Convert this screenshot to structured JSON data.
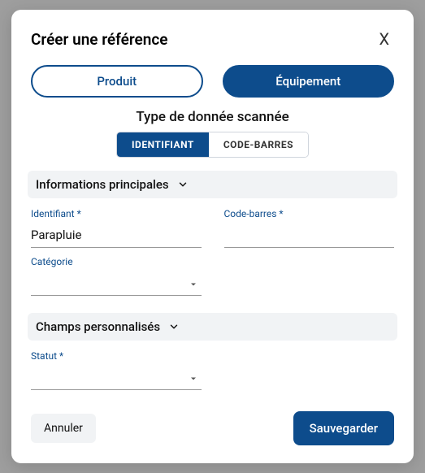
{
  "modal": {
    "title": "Créer une référence",
    "close": "X"
  },
  "tabs": {
    "product": "Produit",
    "equipment": "Équipement"
  },
  "scan": {
    "title": "Type de donnée scannée",
    "identifier": "IDENTIFIANT",
    "barcode": "CODE-BARRES"
  },
  "sections": {
    "main": "Informations principales",
    "custom": "Champs personnalisés"
  },
  "fields": {
    "identifier_label": "Identifiant *",
    "identifier_value": "Parapluie",
    "barcode_label": "Code-barres *",
    "barcode_value": "",
    "category_label": "Catégorie",
    "category_value": "",
    "status_label": "Statut *",
    "status_value": ""
  },
  "footer": {
    "cancel": "Annuler",
    "save": "Sauvegarder"
  }
}
